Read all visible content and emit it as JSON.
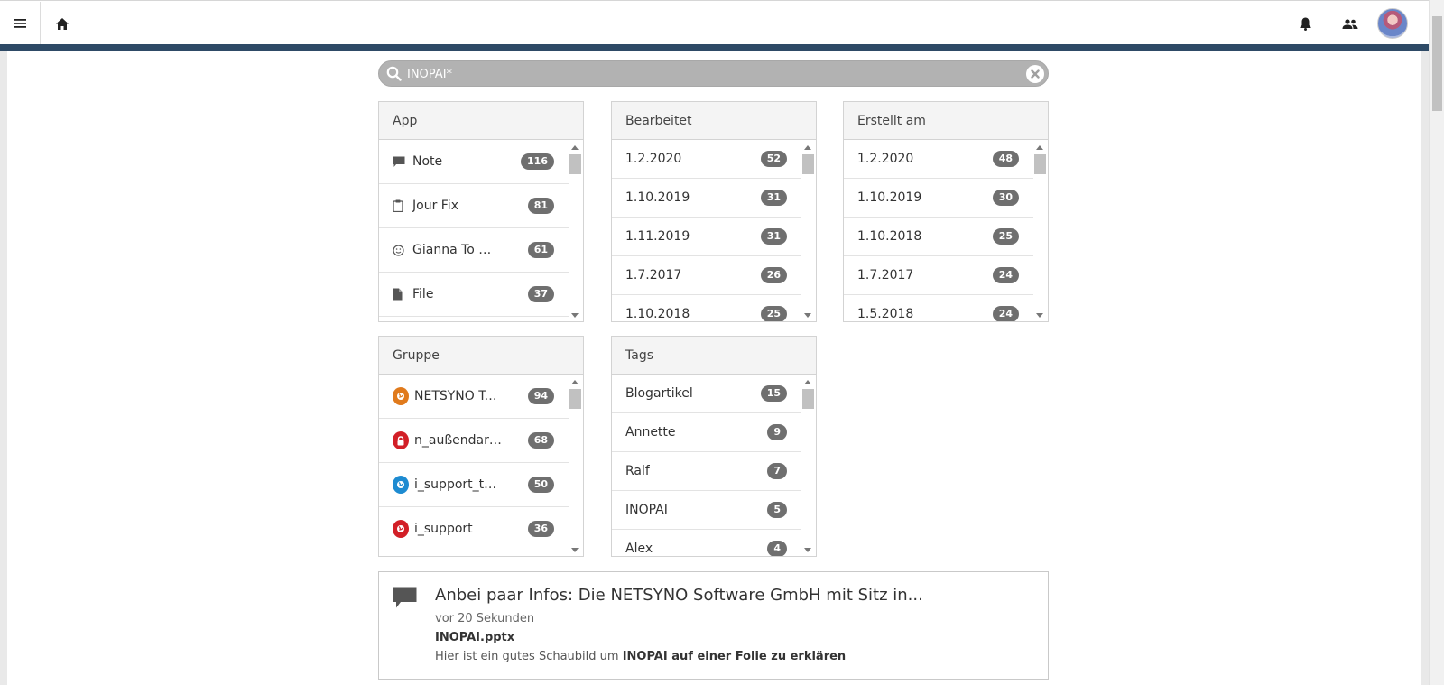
{
  "search": {
    "value": "INOPAI*",
    "placeholder": ""
  },
  "facets": {
    "app": {
      "title": "App",
      "items": [
        {
          "label": "Note",
          "count": "116",
          "icon": "speech-bubble-icon"
        },
        {
          "label": "Jour Fix",
          "count": "81",
          "icon": "clipboard-icon"
        },
        {
          "label": "Gianna To Do Liste",
          "count": "61",
          "icon": "smiley-icon"
        },
        {
          "label": "File",
          "count": "37",
          "icon": "file-icon"
        }
      ]
    },
    "bearbeitet": {
      "title": "Bearbeitet",
      "items": [
        {
          "label": "1.2.2020",
          "count": "52"
        },
        {
          "label": "1.10.2019",
          "count": "31"
        },
        {
          "label": "1.11.2019",
          "count": "31"
        },
        {
          "label": "1.7.2017",
          "count": "26"
        },
        {
          "label": "1.10.2018",
          "count": "25"
        }
      ]
    },
    "erstellt": {
      "title": "Erstellt am",
      "items": [
        {
          "label": "1.2.2020",
          "count": "48"
        },
        {
          "label": "1.10.2019",
          "count": "30"
        },
        {
          "label": "1.10.2018",
          "count": "25"
        },
        {
          "label": "1.7.2017",
          "count": "24"
        },
        {
          "label": "1.5.2018",
          "count": "24"
        }
      ]
    },
    "gruppe": {
      "title": "Gruppe",
      "items": [
        {
          "label": "NETSYNO Team",
          "count": "94",
          "color": "#e07a1c",
          "icon": "group-globe-icon"
        },
        {
          "label": "n_außendarstellung",
          "count": "68",
          "color": "#d21f27",
          "icon": "lock-icon"
        },
        {
          "label": "i_support_tutorials",
          "count": "50",
          "color": "#1d8bd1",
          "icon": "group-globe-icon"
        },
        {
          "label": "i_support",
          "count": "36",
          "color": "#d21f27",
          "icon": "group-globe-icon"
        }
      ]
    },
    "tags": {
      "title": "Tags",
      "items": [
        {
          "label": "Blogartikel",
          "count": "15"
        },
        {
          "label": "Annette",
          "count": "9"
        },
        {
          "label": "Ralf",
          "count": "7"
        },
        {
          "label": "INOPAI",
          "count": "5"
        },
        {
          "label": "Alex",
          "count": "4"
        }
      ]
    }
  },
  "result": {
    "title": "Anbei paar Infos: Die NETSYNO Software GmbH mit Sitz in...",
    "time": "vor 20 Sekunden",
    "file": "INOPAI.pptx",
    "snippet_prefix": "Hier ist ein gutes Schaubild um",
    "snippet_bold": "INOPAI auf einer Folie zu erklären"
  },
  "colors": {
    "topbar_accent": "#2e4a66",
    "badge": "#6f6f6f",
    "search_bg": "#b2b2b2"
  }
}
